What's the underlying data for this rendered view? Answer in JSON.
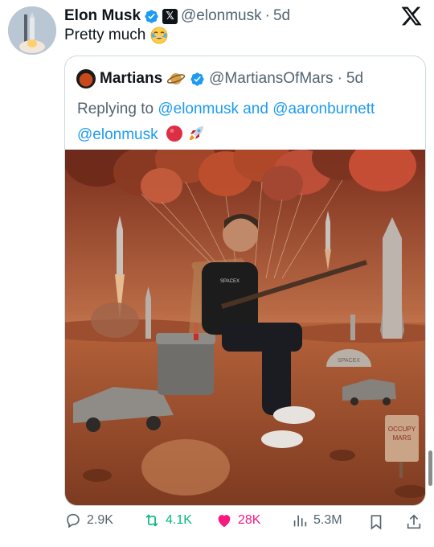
{
  "tweet": {
    "author_name": "Elon Musk",
    "handle": "@elonmusk",
    "separator": "·",
    "time": "5d",
    "text": "Pretty much",
    "emoji_icon": "laughing-tears-emoji-icon"
  },
  "quoted": {
    "author_name": "Martians",
    "handle": "@MartiansOfMars",
    "separator": "·",
    "time": "5d",
    "replying_prefix": "Replying to ",
    "reply_user_1": "@elonmusk",
    "reply_and": " and ",
    "reply_user_2": "@aaronburnett",
    "mention": "@elonmusk",
    "image_texts": {
      "shirt": "SPACEX",
      "dome": "SPACEX",
      "sign_line1": "OCCUPY",
      "sign_line2": "MARS"
    }
  },
  "actions": {
    "replies": "2.9K",
    "reposts": "4.1K",
    "likes": "28K",
    "views": "5.3M"
  },
  "colors": {
    "link": "#1d9bf0",
    "muted": "#536471",
    "repost": "#00ba7c",
    "like": "#f91880",
    "verified": "#1d9bf0"
  }
}
